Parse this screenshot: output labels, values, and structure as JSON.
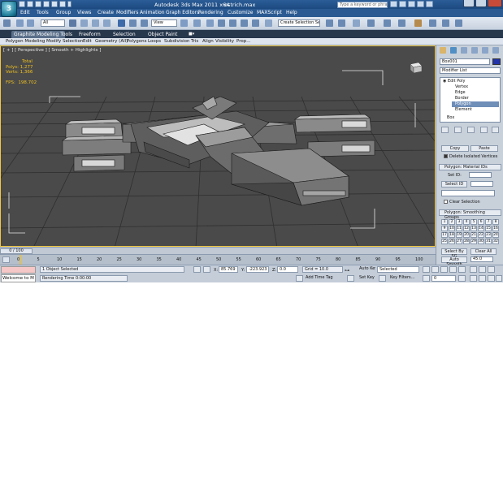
{
  "app": {
    "title": "Autodesk 3ds Max  2011 x64",
    "document": "ostrich.max",
    "logo": "3",
    "search_placeholder": "Type a keyword or phrase"
  },
  "menu": [
    "Edit",
    "Tools",
    "Group",
    "Views",
    "Create",
    "Modifiers",
    "Animation",
    "Graph Editors",
    "Rendering",
    "Customize",
    "MAXScript",
    "Help"
  ],
  "toolbar": {
    "selection_filter": "All",
    "reference_coord": "View",
    "named_selection": "Create Selection Se"
  },
  "graphite": {
    "tabs": [
      "Graphite Modeling Tools",
      "Freeform",
      "Selection",
      "Object Paint"
    ],
    "ribbon_items": [
      "Polygon Modeling",
      "Modify Selection",
      "Edit",
      "Geometry (All)",
      "Polygons",
      "Loops",
      "Subdivision",
      "Tris",
      "Align",
      "Visibility",
      "Prop..."
    ]
  },
  "viewport": {
    "label": "[ + ] [ Perspective ] [ Smooth + Highlights ]",
    "stats": {
      "header": "Total",
      "polys_label": "Polys:",
      "polys": "1,277",
      "verts_label": "Verts:",
      "verts": "1,366",
      "fps_label": "FPS:",
      "fps": "198.702"
    }
  },
  "command_panel": {
    "object_name": "Box001",
    "modifier_list": "Modifier List",
    "stack": [
      {
        "label": "Edit Poly",
        "level": 0,
        "selected": false
      },
      {
        "label": "Vertex",
        "level": 1,
        "selected": false
      },
      {
        "label": "Edge",
        "level": 1,
        "selected": false
      },
      {
        "label": "Border",
        "level": 1,
        "selected": false
      },
      {
        "label": "Polygon",
        "level": 1,
        "selected": true
      },
      {
        "label": "Element",
        "level": 1,
        "selected": false
      },
      {
        "label": "Box",
        "level": 0,
        "selected": false
      }
    ],
    "copy": "Copy",
    "paste": "Paste",
    "delete_isolated": "Delete Isolated Vertices",
    "material_rollout": "Polygon: Material IDs",
    "set_id": "Set ID:",
    "select_id": "Select ID",
    "clear_selection": "Clear Selection",
    "smoothing_rollout": "Polygon: Smoothing Groups",
    "smoothing_groups": [
      "1",
      "2",
      "3",
      "4",
      "5",
      "6",
      "7",
      "8",
      "9",
      "10",
      "11",
      "12",
      "13",
      "14",
      "15",
      "16",
      "17",
      "18",
      "19",
      "20",
      "21",
      "22",
      "23",
      "24",
      "25",
      "26",
      "27",
      "28",
      "29",
      "30",
      "31",
      "32"
    ],
    "select_by_sg": "Select By SG",
    "clear_all": "Clear All",
    "auto_smooth": "Auto Smooth",
    "auto_smooth_value": "45.0"
  },
  "timeline": {
    "frame_display": "0 / 100",
    "ticks": [
      "0",
      "5",
      "10",
      "15",
      "20",
      "25",
      "30",
      "35",
      "40",
      "45",
      "50",
      "55",
      "60",
      "65",
      "70",
      "75",
      "80",
      "85",
      "90",
      "95",
      "100"
    ]
  },
  "status": {
    "maxscript_output": "Welcome to M",
    "selection_info": "1 Object Selected",
    "prompt": "Rendering Time  0:00:00",
    "x_label": "X:",
    "x_value": "85.769",
    "y_label": "Y:",
    "y_value": "-223.923",
    "z_label": "Z:",
    "z_value": "0.0",
    "grid": "Grid = 10.0",
    "add_time_tag": "Add Time Tag",
    "auto_key": "Auto Key",
    "set_key": "Set Key",
    "selected_dropdown": "Selected",
    "key_filters": "Key Filters...",
    "current_frame": "0"
  }
}
